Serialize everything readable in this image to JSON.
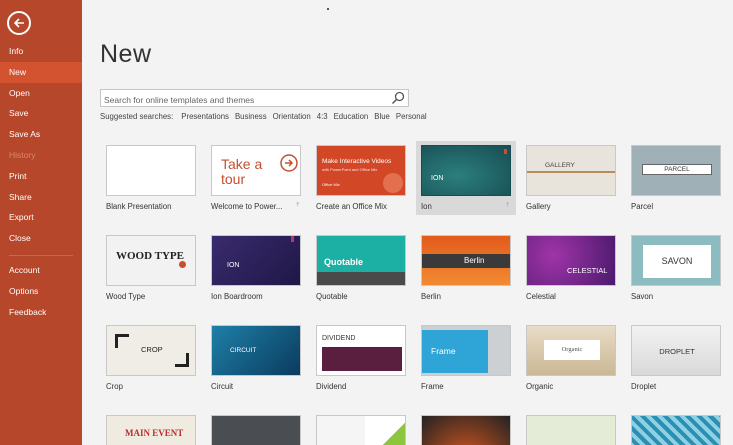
{
  "sidebar": {
    "back_label": "Back",
    "items": [
      {
        "label": "Info"
      },
      {
        "label": "New"
      },
      {
        "label": "Open"
      },
      {
        "label": "Save"
      },
      {
        "label": "Save As"
      },
      {
        "label": "History"
      },
      {
        "label": "Print"
      },
      {
        "label": "Share"
      },
      {
        "label": "Export"
      },
      {
        "label": "Close"
      }
    ],
    "bottom_items": [
      {
        "label": "Account"
      },
      {
        "label": "Options"
      },
      {
        "label": "Feedback"
      }
    ],
    "active": "New",
    "disabled": "History",
    "color": "#b7472a"
  },
  "page": {
    "title": "New"
  },
  "search": {
    "placeholder": "Search for online templates and themes"
  },
  "suggested": {
    "label": "Suggested searches:",
    "items": [
      "Presentations",
      "Business",
      "Orientation",
      "4:3",
      "Education",
      "Blue",
      "Personal"
    ]
  },
  "templates": [
    {
      "label": "Blank Presentation"
    },
    {
      "label": "Welcome to Power...",
      "thumb": "Take a tour"
    },
    {
      "label": "Create an Office Mix",
      "thumb": "Make Interactive Videos",
      "thumb_sub": "with PowerPoint and Office Mix",
      "thumb_badge": "Office Mix"
    },
    {
      "label": "Ion",
      "thumb": "ION",
      "selected": true
    },
    {
      "label": "Gallery",
      "thumb": "GALLERY"
    },
    {
      "label": "Parcel",
      "thumb": "PARCEL"
    },
    {
      "label": "Wood Type",
      "thumb": "WOOD TYPE"
    },
    {
      "label": "Ion Boardroom",
      "thumb": "ION"
    },
    {
      "label": "Quotable",
      "thumb": "Quotable"
    },
    {
      "label": "Berlin",
      "thumb": "Berlin"
    },
    {
      "label": "Celestial",
      "thumb": "CELESTIAL"
    },
    {
      "label": "Savon",
      "thumb": "SAVON"
    },
    {
      "label": "Crop",
      "thumb": "CROP"
    },
    {
      "label": "Circuit",
      "thumb": "CIRCUIT"
    },
    {
      "label": "Dividend",
      "thumb": "DIVIDEND"
    },
    {
      "label": "Frame",
      "thumb": "Frame"
    },
    {
      "label": "Organic",
      "thumb": "Organic"
    },
    {
      "label": "Droplet",
      "thumb": "DROPLET"
    },
    {
      "label": "",
      "thumb": "MAIN EVENT"
    }
  ]
}
